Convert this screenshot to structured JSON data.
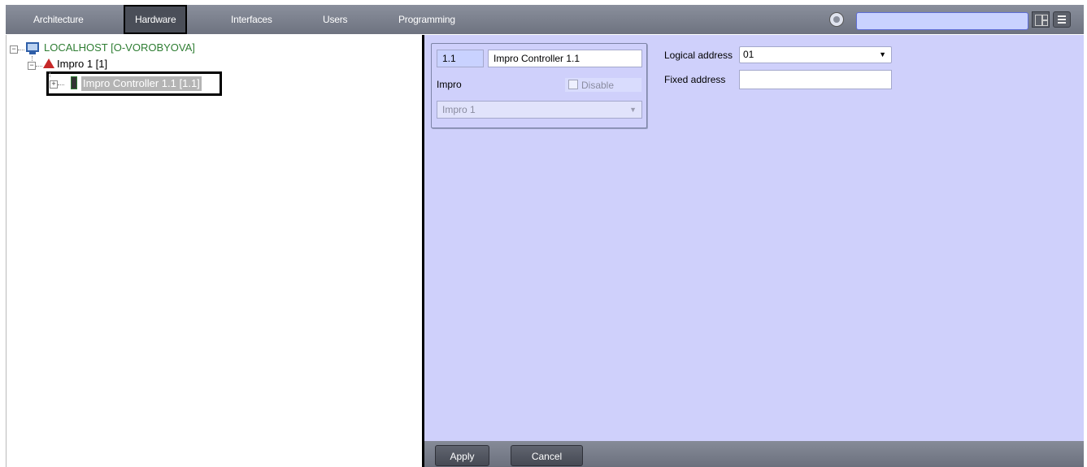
{
  "nav": {
    "tabs": [
      {
        "label": "Architecture"
      },
      {
        "label": "Hardware"
      },
      {
        "label": "Interfaces"
      },
      {
        "label": "Users"
      },
      {
        "label": "Programming"
      }
    ],
    "active": "Hardware",
    "search_value": ""
  },
  "tree": {
    "root_label": "LOCALHOST [O-VOROBYOVA]",
    "impro_label": "Impro 1 [1]",
    "controller_label": "Impro Controller 1.1 [1.1]"
  },
  "panel": {
    "id_value": "1.1",
    "name_value": "Impro Controller 1.1",
    "type_label": "Impro",
    "disable_label": "Disable",
    "parent_value": "Impro 1",
    "logical_address_label": "Logical address",
    "logical_address_value": "01",
    "fixed_address_label": "Fixed address",
    "fixed_address_value": ""
  },
  "buttons": {
    "apply": "Apply",
    "cancel": "Cancel"
  },
  "colors": {
    "panel_bg": "#cfd0fb",
    "topbar": "#7a7f8c",
    "tree_root_text": "#2e7d32",
    "selection": "#b4b4b4"
  }
}
